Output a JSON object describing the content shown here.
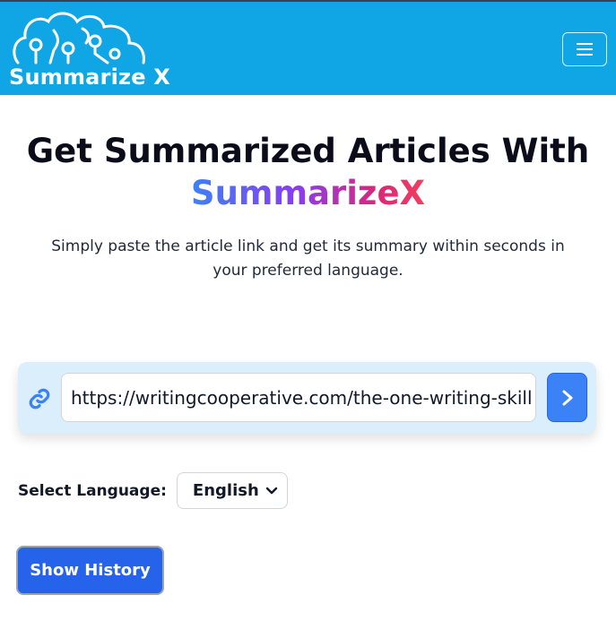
{
  "header": {
    "logo_text": "Summarize X",
    "logo_icon": "cloud-circuit-icon",
    "menu_icon": "hamburger-menu-icon",
    "background": "#10a6e6"
  },
  "hero": {
    "title_line1": "Get Summarized Articles With",
    "title_line2": "SummarizeX",
    "subtitle": "Simply paste the article link and get its summary within seconds in your preferred language."
  },
  "search": {
    "link_icon": "link-icon",
    "url_value": "https://writingcooperative.com/the-one-writing-skill",
    "submit_icon": "chevron-right-icon"
  },
  "language": {
    "label": "Select Language:",
    "selected": "English",
    "dropdown_icon": "chevron-down-icon"
  },
  "history": {
    "button_label": "Show History"
  },
  "colors": {
    "accent": "#3b82f6",
    "primary_button": "#2563eb",
    "gradient": [
      "#3b82f6",
      "#8b3cf0",
      "#db2777",
      "#f43f5e"
    ]
  }
}
